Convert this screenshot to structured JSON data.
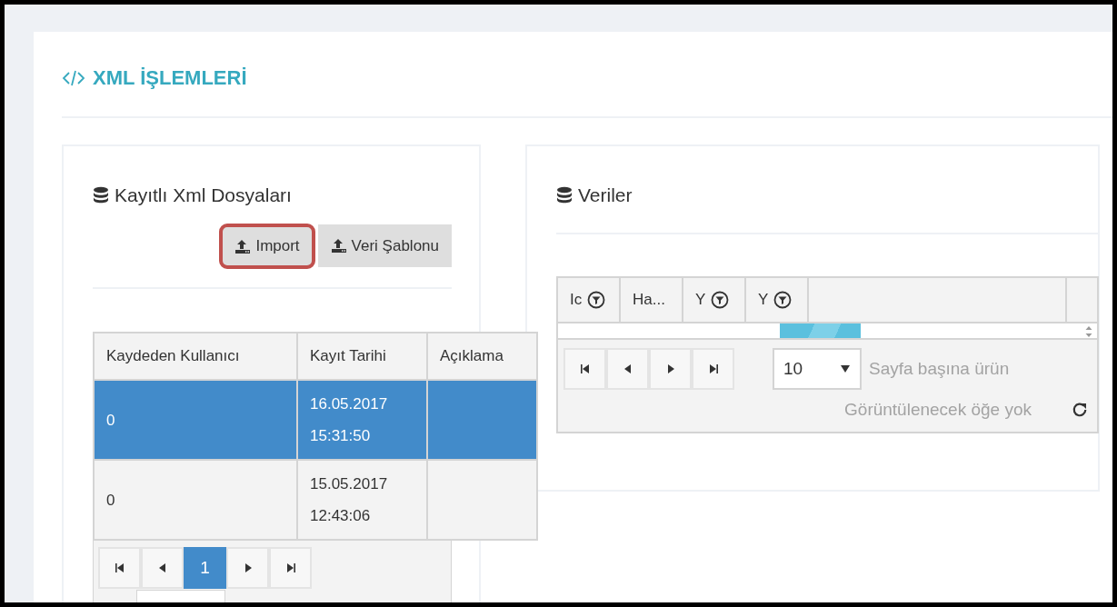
{
  "page_title": "XML İŞLEMLERİ",
  "files_panel": {
    "title": "Kayıtlı Xml Dosyaları",
    "buttons": [
      {
        "label": "Import",
        "highlighted": true
      },
      {
        "label": "Veri Şablonu",
        "highlighted": false
      }
    ],
    "table": {
      "columns": [
        "Kaydeden Kullanıcı",
        "Kayıt Tarihi",
        "Açıklama"
      ],
      "rows": [
        {
          "selected": true,
          "cells": [
            "0",
            "16.05.2017 15:31:50",
            ""
          ]
        },
        {
          "selected": false,
          "cells": [
            "0",
            "15.05.2017 12:43:06",
            ""
          ]
        }
      ]
    },
    "pager": {
      "pages": [
        {
          "label": "1",
          "selected": true
        }
      ]
    }
  },
  "data_panel": {
    "title": "Veriler",
    "grid": {
      "columns": [
        {
          "label": "Ic",
          "filter": true
        },
        {
          "label": "Ha...",
          "filter": false
        },
        {
          "label": "Y",
          "filter": true
        },
        {
          "label": "Y",
          "filter": true
        }
      ],
      "page_size": "10",
      "page_size_label": "Sayfa başına ürün",
      "empty_message": "Görüntülenecek öğe yok"
    }
  }
}
